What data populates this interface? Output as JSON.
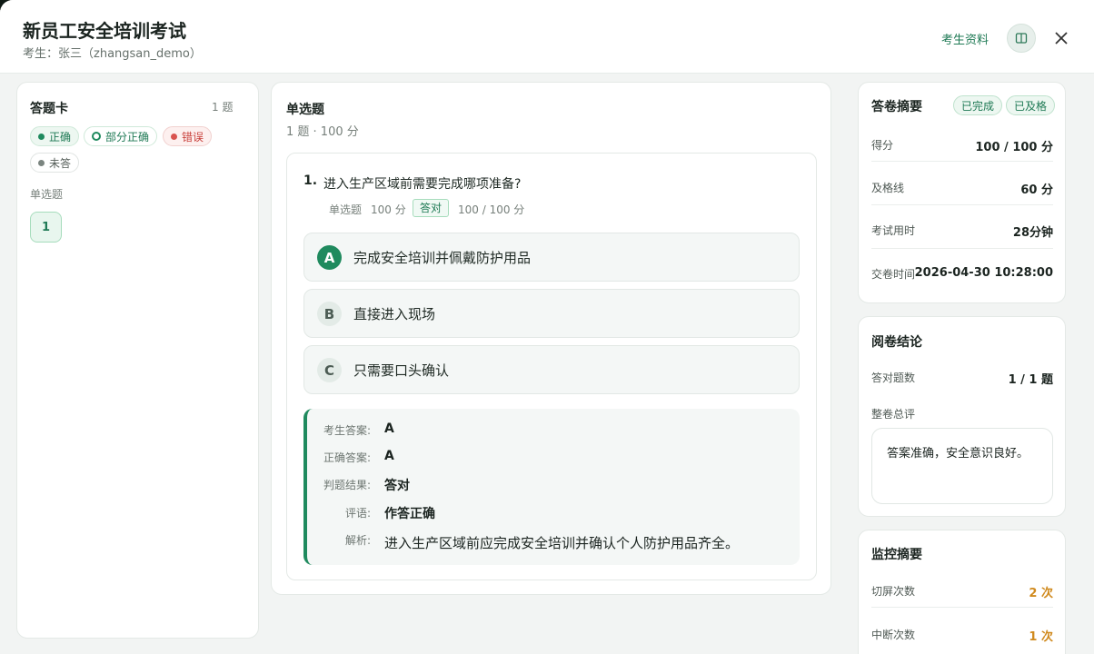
{
  "header": {
    "title": "新员工安全培训考试",
    "subtitle": "考生：张三（zhangsan_demo）",
    "materials_link": "考生资料"
  },
  "answer_card": {
    "title": "答题卡",
    "count": "1 题",
    "legend": {
      "correct": "正确",
      "partial": "部分正确",
      "wrong": "错误",
      "unanswered": "未答"
    },
    "section": "单选题",
    "questions": [
      "1"
    ]
  },
  "section": {
    "title": "单选题",
    "meta": "1 题 · 100 分"
  },
  "question": {
    "number": "1.",
    "text": "进入生产区域前需要完成哪项准备?",
    "type": "单选题",
    "points": "100 分",
    "status": "答对",
    "score": "100 / 100 分",
    "options": [
      {
        "letter": "A",
        "text": "完成安全培训并佩戴防护用品",
        "selected": true
      },
      {
        "letter": "B",
        "text": "直接进入现场",
        "selected": false
      },
      {
        "letter": "C",
        "text": "只需要口头确认",
        "selected": false
      }
    ],
    "review": {
      "candidate_label": "考生答案:",
      "candidate_value": "A",
      "correct_label": "正确答案:",
      "correct_value": "A",
      "result_label": "判题结果:",
      "result_value": "答对",
      "comment_label": "评语:",
      "comment_value": "作答正确",
      "analysis_label": "解析:",
      "analysis_value": "进入生产区域前应完成安全培训并确认个人防护用品齐全。"
    }
  },
  "summary": {
    "title": "答卷摘要",
    "tags": [
      "已完成",
      "已及格"
    ],
    "rows": [
      {
        "label": "得分",
        "value": "100 / 100 分"
      },
      {
        "label": "及格线",
        "value": "60 分"
      },
      {
        "label": "考试用时",
        "value": "28分钟"
      },
      {
        "label": "交卷时间",
        "value": "2026-04-30 10:28:00"
      }
    ]
  },
  "conclusion": {
    "title": "阅卷结论",
    "correct_label": "答对题数",
    "correct_value": "1 / 1 题",
    "overall_label": "整卷总评",
    "overall_text": "答案准确，安全意识良好。"
  },
  "monitor": {
    "title": "监控摘要",
    "rows": [
      {
        "label": "切屏次数",
        "value": "2 次"
      },
      {
        "label": "中断次数",
        "value": "1 次"
      }
    ]
  },
  "colors": {
    "brand": "#1f8a5e",
    "warning": "#d08a1e",
    "error": "#d9534f"
  }
}
